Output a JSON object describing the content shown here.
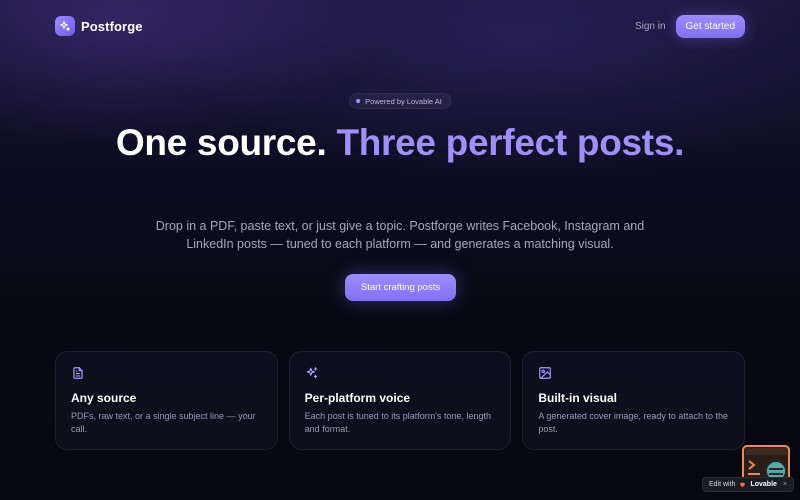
{
  "header": {
    "brand": "Postforge",
    "sign_in": "Sign in",
    "get_started": "Get started"
  },
  "hero": {
    "badge": "Powered by Lovable AI",
    "title_part1": "One source.",
    "title_part2": "Three perfect posts.",
    "subtitle": "Drop in a PDF, paste text, or just give a topic. Postforge writes Facebook, Instagram and LinkedIn posts — tuned to each platform — and generates a matching visual.",
    "cta": "Start crafting posts"
  },
  "features": [
    {
      "icon": "document-icon",
      "title": "Any source",
      "description": "PDFs, raw text, or a single subject line — your call."
    },
    {
      "icon": "sparkles-icon",
      "title": "Per-platform voice",
      "description": "Each post is tuned to its platform's tone, length and format."
    },
    {
      "icon": "image-icon",
      "title": "Built-in visual",
      "description": "A generated cover image, ready to attach to the post."
    }
  ],
  "badge": {
    "edit_with": "Edit with",
    "brand": "Lovable",
    "close": "×"
  },
  "colors": {
    "accent": "#a08ff5",
    "button": "#8f7ef7",
    "background": "#0a0a17"
  }
}
